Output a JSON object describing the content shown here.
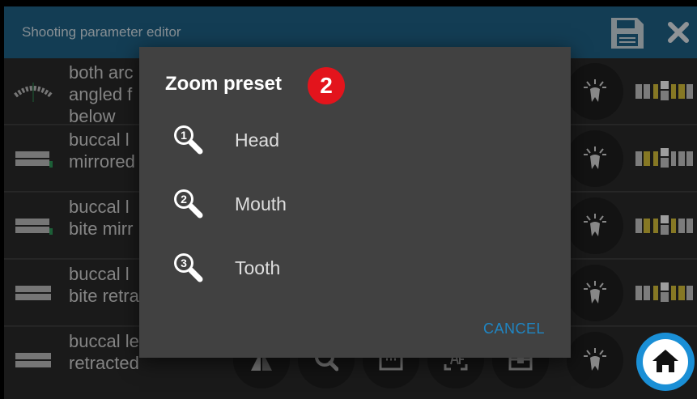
{
  "header": {
    "title": "Shooting parameter editor"
  },
  "rows": [
    {
      "label_line1": "both arc",
      "label_line2": "angled f",
      "label_line3": "below"
    },
    {
      "label_line1": "buccal l",
      "label_line2": "mirrored"
    },
    {
      "label_line1": "buccal l",
      "label_line2": "bite mirr"
    },
    {
      "label_line1": "buccal l",
      "label_line2": "bite retra"
    },
    {
      "label_line1": "buccal left",
      "label_line2": "retracted"
    }
  ],
  "dialog": {
    "title": "Zoom preset",
    "badge": "2",
    "options": [
      {
        "label": "Head",
        "icon": "zoom-1-icon"
      },
      {
        "label": "Mouth",
        "icon": "zoom-2-icon"
      },
      {
        "label": "Tooth",
        "icon": "zoom-3-icon"
      }
    ],
    "icon_digits": [
      "1",
      "2",
      "3"
    ],
    "cancel_label": "CANCEL"
  },
  "bottom_row_icons": [
    "flip-icon",
    "zoom-2-icon",
    "frame-icon",
    "af-icon",
    "exposure-icon",
    "tooth-light-icon"
  ],
  "colors": {
    "header": "#1f6388",
    "badge": "#e3141c",
    "accent": "#1a8fd6",
    "cancel": "#1f86c4"
  }
}
